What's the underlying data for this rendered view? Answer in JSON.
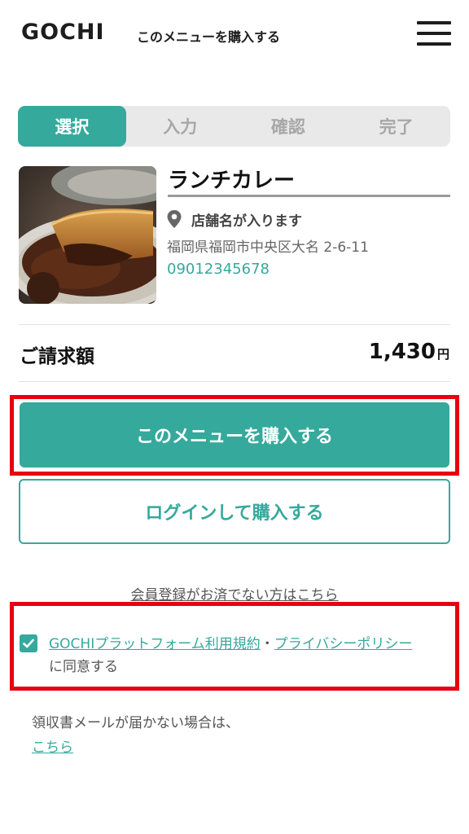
{
  "header": {
    "logo": "GOCHI",
    "title": "このメニューを購入する"
  },
  "steps": [
    {
      "label": "選択",
      "active": true
    },
    {
      "label": "入力",
      "active": false
    },
    {
      "label": "確認",
      "active": false
    },
    {
      "label": "完了",
      "active": false
    }
  ],
  "item": {
    "name": "ランチカレー",
    "shop_name": "店舗名が入ります",
    "address": "福岡県福岡市中央区大名 2-6-11",
    "phone": "09012345678"
  },
  "total": {
    "label": "ご請求額",
    "amount": "1,430",
    "currency": "円"
  },
  "buttons": {
    "buy": "このメニューを購入する",
    "login": "ログインして購入する"
  },
  "register_link": "会員登録がお済でない方はこちら",
  "agreement": {
    "checked": true,
    "terms_link": "GOCHIプラットフォーム利用規約",
    "separator": "・",
    "privacy_link": "プライバシーポリシー",
    "suffix": "に同意する"
  },
  "receipt": {
    "text": "領収書メールが届かない場合は、",
    "link": "こちら"
  },
  "colors": {
    "accent": "#35a99c",
    "highlight": "#e60012"
  }
}
